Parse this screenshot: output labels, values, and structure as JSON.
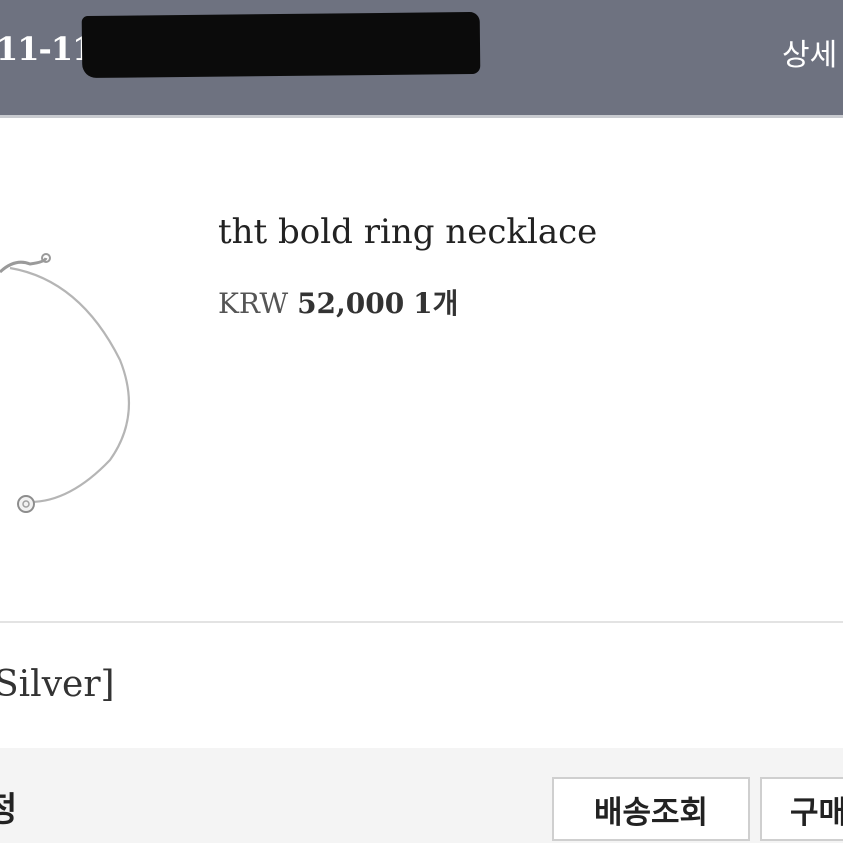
{
  "header": {
    "order_date_partial": "11-11",
    "detail_link": "상세"
  },
  "product": {
    "name": "tht bold ring necklace",
    "currency": "KRW",
    "price": "52,000",
    "quantity": "1개",
    "image_icon": "necklace-image"
  },
  "option": {
    "text": "Silver]"
  },
  "footer": {
    "status_partial": "정",
    "track_button": "배송조회",
    "confirm_button_partial": "구매"
  },
  "colors": {
    "header_bg": "#6e7280",
    "bottom_bar_bg": "#f4f4f4"
  }
}
